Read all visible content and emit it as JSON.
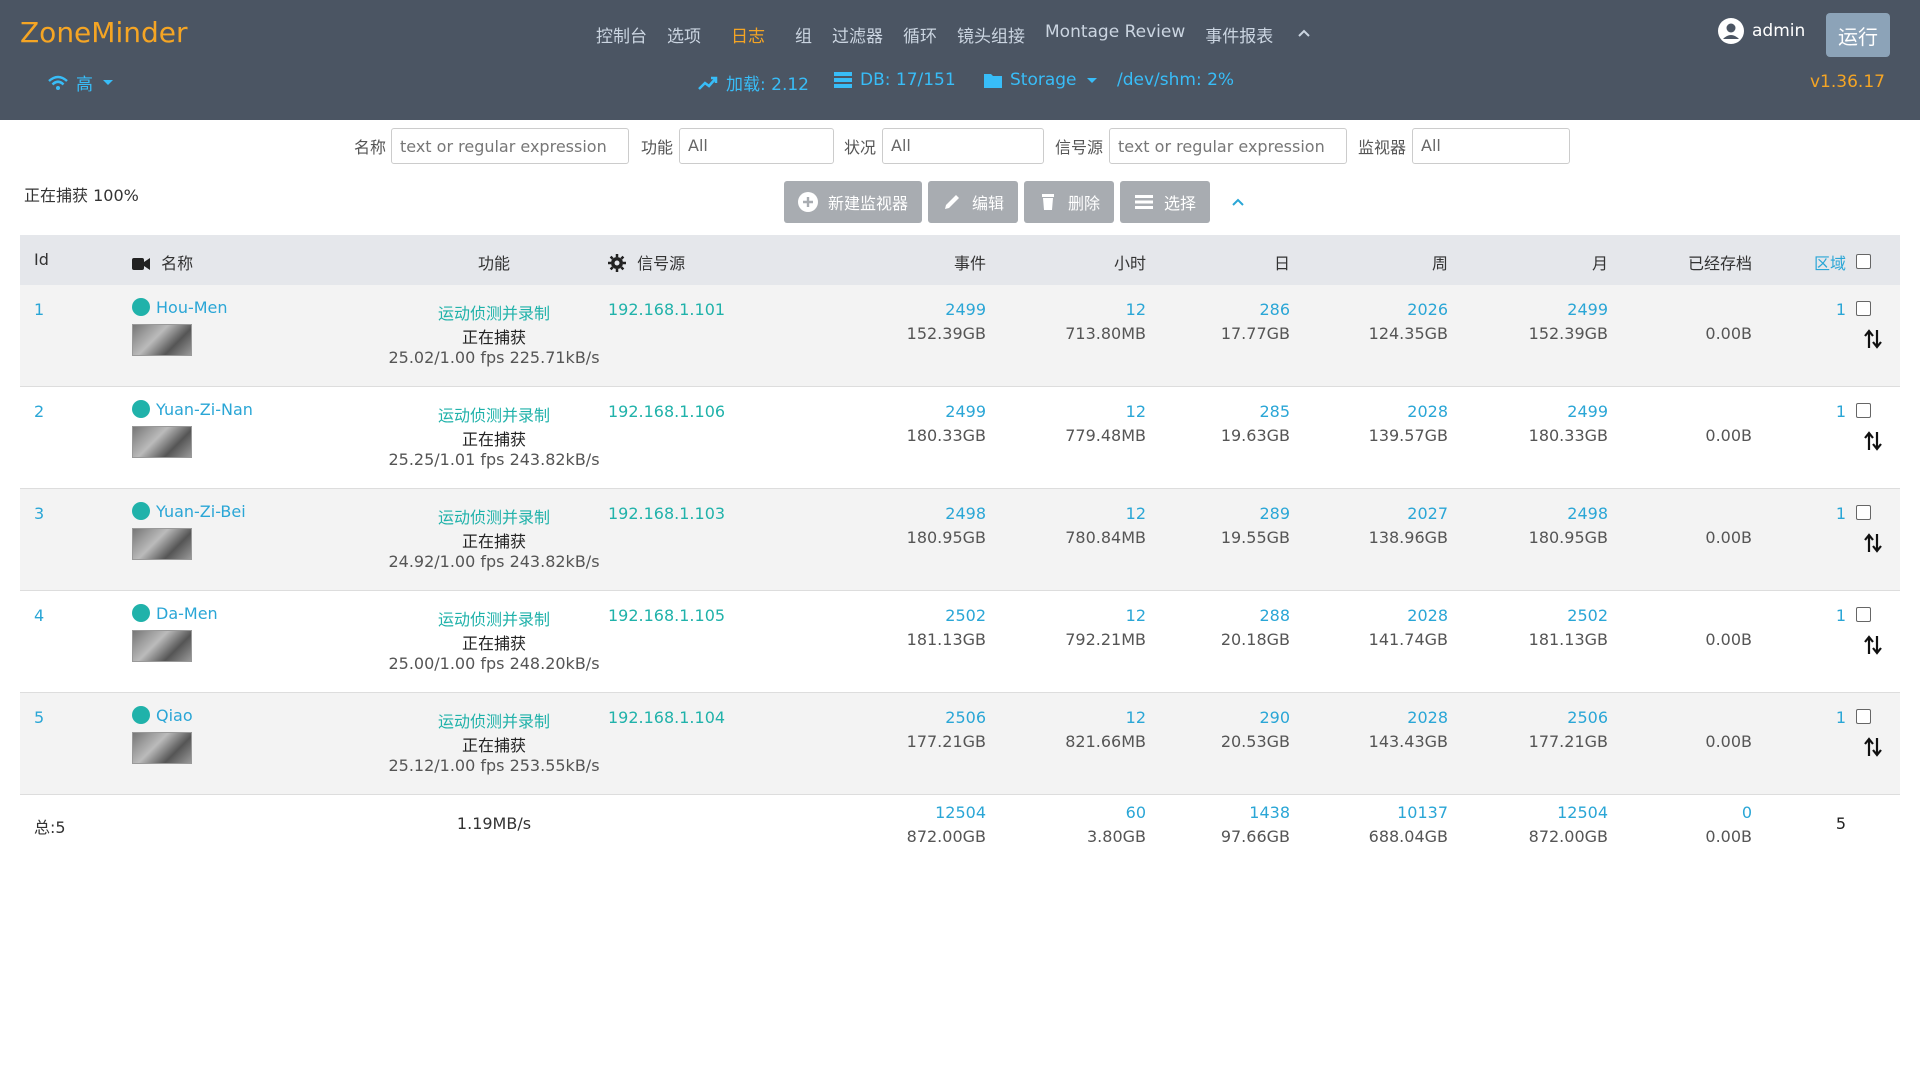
{
  "header": {
    "brand": "ZoneMinder",
    "nav": [
      "控制台",
      "选项",
      "日志",
      "组",
      "过滤器",
      "循环",
      "镜头组接",
      "Montage Review",
      "事件报表"
    ],
    "nav_active": "日志",
    "user": "admin",
    "run_button": "运行",
    "bandwidth": "高",
    "load": "加载: 2.12",
    "db": "DB: 17/151",
    "storage": "Storage",
    "shm": "/dev/shm: 2%",
    "version": "v1.36.17"
  },
  "filters": {
    "name_label": "名称",
    "name_placeholder": "text or regular expression",
    "function_label": "功能",
    "function_value": "All",
    "status_label": "状况",
    "status_value": "All",
    "source_label": "信号源",
    "source_placeholder": "text or regular expression",
    "monitor_label": "监视器",
    "monitor_value": "All"
  },
  "capturing": "正在捕获 100%",
  "toolbar": {
    "new": "新建监视器",
    "edit": "编辑",
    "delete": "删除",
    "select": "选择"
  },
  "columns": {
    "id": "Id",
    "name": "名称",
    "function": "功能",
    "source": "信号源",
    "events": "事件",
    "hour": "小时",
    "day": "日",
    "week": "周",
    "month": "月",
    "archived": "已经存档",
    "zones": "区域"
  },
  "monitors": [
    {
      "id": "1",
      "name": "Hou-Men",
      "func": "运动侦测并录制",
      "state": "正在捕获",
      "fps": "25.02/1.00 fps 225.71kB/s",
      "source": "192.168.1.101",
      "events": "2499",
      "events_size": "152.39GB",
      "hour": "12",
      "hour_size": "713.80MB",
      "day": "286",
      "day_size": "17.77GB",
      "week": "2026",
      "week_size": "124.35GB",
      "month": "2499",
      "month_size": "152.39GB",
      "archived": "0.00B",
      "zones": "1"
    },
    {
      "id": "2",
      "name": "Yuan-Zi-Nan",
      "func": "运动侦测并录制",
      "state": "正在捕获",
      "fps": "25.25/1.01 fps 243.82kB/s",
      "source": "192.168.1.106",
      "events": "2499",
      "events_size": "180.33GB",
      "hour": "12",
      "hour_size": "779.48MB",
      "day": "285",
      "day_size": "19.63GB",
      "week": "2028",
      "week_size": "139.57GB",
      "month": "2499",
      "month_size": "180.33GB",
      "archived": "0.00B",
      "zones": "1"
    },
    {
      "id": "3",
      "name": "Yuan-Zi-Bei",
      "func": "运动侦测并录制",
      "state": "正在捕获",
      "fps": "24.92/1.00 fps 243.82kB/s",
      "source": "192.168.1.103",
      "events": "2498",
      "events_size": "180.95GB",
      "hour": "12",
      "hour_size": "780.84MB",
      "day": "289",
      "day_size": "19.55GB",
      "week": "2027",
      "week_size": "138.96GB",
      "month": "2498",
      "month_size": "180.95GB",
      "archived": "0.00B",
      "zones": "1"
    },
    {
      "id": "4",
      "name": "Da-Men",
      "func": "运动侦测并录制",
      "state": "正在捕获",
      "fps": "25.00/1.00 fps 248.20kB/s",
      "source": "192.168.1.105",
      "events": "2502",
      "events_size": "181.13GB",
      "hour": "12",
      "hour_size": "792.21MB",
      "day": "288",
      "day_size": "20.18GB",
      "week": "2028",
      "week_size": "141.74GB",
      "month": "2502",
      "month_size": "181.13GB",
      "archived": "0.00B",
      "zones": "1"
    },
    {
      "id": "5",
      "name": "Qiao",
      "func": "运动侦测并录制",
      "state": "正在捕获",
      "fps": "25.12/1.00 fps 253.55kB/s",
      "source": "192.168.1.104",
      "events": "2506",
      "events_size": "177.21GB",
      "hour": "12",
      "hour_size": "821.66MB",
      "day": "290",
      "day_size": "20.53GB",
      "week": "2028",
      "week_size": "143.43GB",
      "month": "2506",
      "month_size": "177.21GB",
      "archived": "0.00B",
      "zones": "1"
    }
  ],
  "totals": {
    "label": "总:5",
    "bandwidth": "1.19MB/s",
    "events": "12504",
    "events_size": "872.00GB",
    "hour": "60",
    "hour_size": "3.80GB",
    "day": "1438",
    "day_size": "97.66GB",
    "week": "10137",
    "week_size": "688.04GB",
    "month": "12504",
    "month_size": "872.00GB",
    "archived": "0",
    "archived_size": "0.00B",
    "zones": "5"
  }
}
